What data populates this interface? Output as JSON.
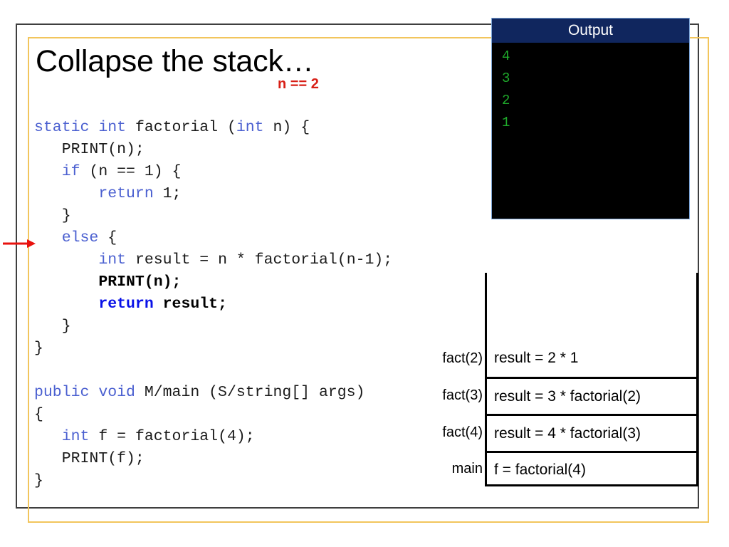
{
  "slide": {
    "title": "Collapse the stack…",
    "annotation": "n == 2",
    "pointer_icon": "red-right-arrow"
  },
  "colors": {
    "outer_frame": "#3f3f3f",
    "gold_frame": "#f2c55c",
    "annotation_red": "#d81f16",
    "keyword_blue": "#4a5fd0",
    "keyword_bold_blue": "#0a12e8",
    "console_title_bg": "#10265e",
    "console_bg": "#000000",
    "console_text_green": "#1faa2b"
  },
  "code": {
    "lines": [
      [
        {
          "t": "static",
          "s": "kw"
        },
        {
          "t": " ",
          "s": ""
        },
        {
          "t": "int",
          "s": "kw"
        },
        {
          "t": " factorial (",
          "s": ""
        },
        {
          "t": "int",
          "s": "kw"
        },
        {
          "t": " n) {",
          "s": ""
        }
      ],
      [
        {
          "t": "   PRINT(n);",
          "s": ""
        }
      ],
      [
        {
          "t": "   ",
          "s": ""
        },
        {
          "t": "if",
          "s": "kw"
        },
        {
          "t": " (n == 1) {",
          "s": ""
        }
      ],
      [
        {
          "t": "       ",
          "s": ""
        },
        {
          "t": "return",
          "s": "kw"
        },
        {
          "t": " 1;",
          "s": ""
        }
      ],
      [
        {
          "t": "   }",
          "s": ""
        }
      ],
      [
        {
          "t": "   ",
          "s": ""
        },
        {
          "t": "else",
          "s": "kw"
        },
        {
          "t": " {",
          "s": ""
        }
      ],
      [
        {
          "t": "       ",
          "s": ""
        },
        {
          "t": "int",
          "s": "kw"
        },
        {
          "t": " result = n * factorial(n-1);",
          "s": ""
        }
      ],
      [
        {
          "t": "       ",
          "s": ""
        },
        {
          "t": "PRINT(n);",
          "s": "bold"
        }
      ],
      [
        {
          "t": "       ",
          "s": ""
        },
        {
          "t": "return",
          "s": "kwb"
        },
        {
          "t": " ",
          "s": ""
        },
        {
          "t": "result;",
          "s": "bold"
        }
      ],
      [
        {
          "t": "   }",
          "s": ""
        }
      ],
      [
        {
          "t": "}",
          "s": ""
        }
      ],
      [
        {
          "t": " ",
          "s": ""
        }
      ],
      [
        {
          "t": "public",
          "s": "kw"
        },
        {
          "t": " ",
          "s": ""
        },
        {
          "t": "void",
          "s": "kw"
        },
        {
          "t": " M/main (S/string[] args)",
          "s": ""
        }
      ],
      [
        {
          "t": "{",
          "s": ""
        }
      ],
      [
        {
          "t": "   ",
          "s": ""
        },
        {
          "t": "int",
          "s": "kw"
        },
        {
          "t": " f = factorial(4);",
          "s": ""
        }
      ],
      [
        {
          "t": "   PRINT(f);",
          "s": ""
        }
      ],
      [
        {
          "t": "}",
          "s": ""
        }
      ]
    ]
  },
  "output_window": {
    "title": "Output",
    "lines": [
      "4",
      "3",
      "2",
      "1"
    ]
  },
  "call_stack": {
    "frames": [
      {
        "label": "fact(2)",
        "content": "result = 2 * 1"
      },
      {
        "label": "fact(3)",
        "content": "result = 3 * factorial(2)"
      },
      {
        "label": "fact(4)",
        "content": "result = 4 * factorial(3)"
      },
      {
        "label": "main",
        "content": "f = factorial(4)"
      }
    ]
  }
}
